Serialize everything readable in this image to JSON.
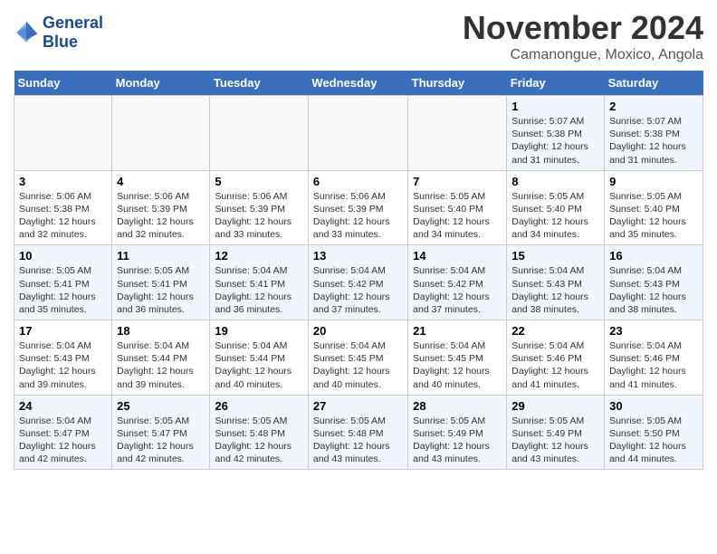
{
  "header": {
    "logo_line1": "General",
    "logo_line2": "Blue",
    "month": "November 2024",
    "location": "Camanongue, Moxico, Angola"
  },
  "weekdays": [
    "Sunday",
    "Monday",
    "Tuesday",
    "Wednesday",
    "Thursday",
    "Friday",
    "Saturday"
  ],
  "weeks": [
    [
      {
        "day": "",
        "info": ""
      },
      {
        "day": "",
        "info": ""
      },
      {
        "day": "",
        "info": ""
      },
      {
        "day": "",
        "info": ""
      },
      {
        "day": "",
        "info": ""
      },
      {
        "day": "1",
        "info": "Sunrise: 5:07 AM\nSunset: 5:38 PM\nDaylight: 12 hours\nand 31 minutes."
      },
      {
        "day": "2",
        "info": "Sunrise: 5:07 AM\nSunset: 5:38 PM\nDaylight: 12 hours\nand 31 minutes."
      }
    ],
    [
      {
        "day": "3",
        "info": "Sunrise: 5:06 AM\nSunset: 5:38 PM\nDaylight: 12 hours\nand 32 minutes."
      },
      {
        "day": "4",
        "info": "Sunrise: 5:06 AM\nSunset: 5:39 PM\nDaylight: 12 hours\nand 32 minutes."
      },
      {
        "day": "5",
        "info": "Sunrise: 5:06 AM\nSunset: 5:39 PM\nDaylight: 12 hours\nand 33 minutes."
      },
      {
        "day": "6",
        "info": "Sunrise: 5:06 AM\nSunset: 5:39 PM\nDaylight: 12 hours\nand 33 minutes."
      },
      {
        "day": "7",
        "info": "Sunrise: 5:05 AM\nSunset: 5:40 PM\nDaylight: 12 hours\nand 34 minutes."
      },
      {
        "day": "8",
        "info": "Sunrise: 5:05 AM\nSunset: 5:40 PM\nDaylight: 12 hours\nand 34 minutes."
      },
      {
        "day": "9",
        "info": "Sunrise: 5:05 AM\nSunset: 5:40 PM\nDaylight: 12 hours\nand 35 minutes."
      }
    ],
    [
      {
        "day": "10",
        "info": "Sunrise: 5:05 AM\nSunset: 5:41 PM\nDaylight: 12 hours\nand 35 minutes."
      },
      {
        "day": "11",
        "info": "Sunrise: 5:05 AM\nSunset: 5:41 PM\nDaylight: 12 hours\nand 36 minutes."
      },
      {
        "day": "12",
        "info": "Sunrise: 5:04 AM\nSunset: 5:41 PM\nDaylight: 12 hours\nand 36 minutes."
      },
      {
        "day": "13",
        "info": "Sunrise: 5:04 AM\nSunset: 5:42 PM\nDaylight: 12 hours\nand 37 minutes."
      },
      {
        "day": "14",
        "info": "Sunrise: 5:04 AM\nSunset: 5:42 PM\nDaylight: 12 hours\nand 37 minutes."
      },
      {
        "day": "15",
        "info": "Sunrise: 5:04 AM\nSunset: 5:43 PM\nDaylight: 12 hours\nand 38 minutes."
      },
      {
        "day": "16",
        "info": "Sunrise: 5:04 AM\nSunset: 5:43 PM\nDaylight: 12 hours\nand 38 minutes."
      }
    ],
    [
      {
        "day": "17",
        "info": "Sunrise: 5:04 AM\nSunset: 5:43 PM\nDaylight: 12 hours\nand 39 minutes."
      },
      {
        "day": "18",
        "info": "Sunrise: 5:04 AM\nSunset: 5:44 PM\nDaylight: 12 hours\nand 39 minutes."
      },
      {
        "day": "19",
        "info": "Sunrise: 5:04 AM\nSunset: 5:44 PM\nDaylight: 12 hours\nand 40 minutes."
      },
      {
        "day": "20",
        "info": "Sunrise: 5:04 AM\nSunset: 5:45 PM\nDaylight: 12 hours\nand 40 minutes."
      },
      {
        "day": "21",
        "info": "Sunrise: 5:04 AM\nSunset: 5:45 PM\nDaylight: 12 hours\nand 40 minutes."
      },
      {
        "day": "22",
        "info": "Sunrise: 5:04 AM\nSunset: 5:46 PM\nDaylight: 12 hours\nand 41 minutes."
      },
      {
        "day": "23",
        "info": "Sunrise: 5:04 AM\nSunset: 5:46 PM\nDaylight: 12 hours\nand 41 minutes."
      }
    ],
    [
      {
        "day": "24",
        "info": "Sunrise: 5:04 AM\nSunset: 5:47 PM\nDaylight: 12 hours\nand 42 minutes."
      },
      {
        "day": "25",
        "info": "Sunrise: 5:05 AM\nSunset: 5:47 PM\nDaylight: 12 hours\nand 42 minutes."
      },
      {
        "day": "26",
        "info": "Sunrise: 5:05 AM\nSunset: 5:48 PM\nDaylight: 12 hours\nand 42 minutes."
      },
      {
        "day": "27",
        "info": "Sunrise: 5:05 AM\nSunset: 5:48 PM\nDaylight: 12 hours\nand 43 minutes."
      },
      {
        "day": "28",
        "info": "Sunrise: 5:05 AM\nSunset: 5:49 PM\nDaylight: 12 hours\nand 43 minutes."
      },
      {
        "day": "29",
        "info": "Sunrise: 5:05 AM\nSunset: 5:49 PM\nDaylight: 12 hours\nand 43 minutes."
      },
      {
        "day": "30",
        "info": "Sunrise: 5:05 AM\nSunset: 5:50 PM\nDaylight: 12 hours\nand 44 minutes."
      }
    ]
  ]
}
